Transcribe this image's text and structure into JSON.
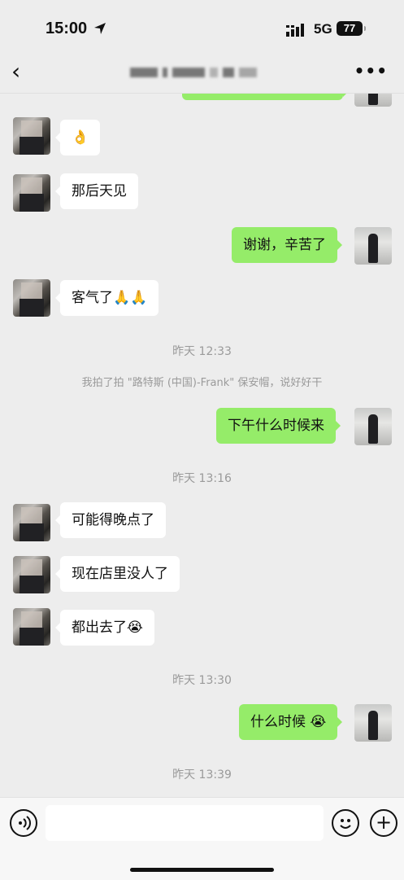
{
  "status": {
    "time": "15:00",
    "network": "5G",
    "battery": "77"
  },
  "nav": {
    "back": "‹",
    "more": "•••"
  },
  "messages": {
    "m1": "👌",
    "m2": "那后天见",
    "m3": "谢谢，辛苦了",
    "m4": "客气了🙏🙏",
    "ts1": "昨天 12:33",
    "sys1": "我拍了拍 \"路特斯 (中国)-Frank\" 保安帽，说好好干",
    "m5": "下午什么时候来",
    "ts2": "昨天 13:16",
    "m6": "可能得晚点了",
    "m7": "现在店里没人了",
    "m8": "都出去了😭",
    "ts3": "昨天 13:30",
    "m9": "什么时候 😭",
    "ts4": "昨天 13:39"
  },
  "input": {
    "value": ""
  },
  "toolbar": {
    "voice_icon": "voice-icon",
    "emoji_icon": "emoji-icon",
    "plus_icon": "plus-icon"
  }
}
